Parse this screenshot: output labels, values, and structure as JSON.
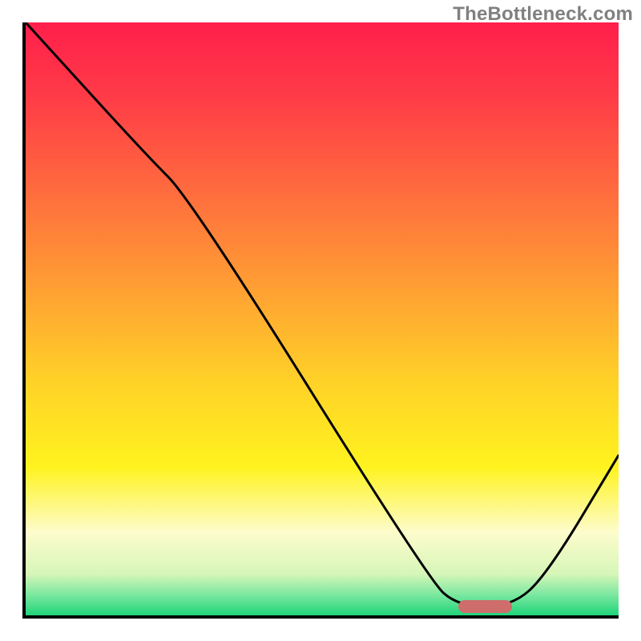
{
  "watermark": "TheBottleneck.com",
  "chart_data": {
    "type": "line",
    "title": "",
    "xlabel": "",
    "ylabel": "",
    "xlim": [
      0,
      100
    ],
    "ylim": [
      0,
      100
    ],
    "gradient_stops": [
      {
        "offset": 0.0,
        "color": "#ff1f4b"
      },
      {
        "offset": 0.12,
        "color": "#ff3a47"
      },
      {
        "offset": 0.28,
        "color": "#ff6a3e"
      },
      {
        "offset": 0.45,
        "color": "#ffa033"
      },
      {
        "offset": 0.6,
        "color": "#ffd028"
      },
      {
        "offset": 0.75,
        "color": "#fff31f"
      },
      {
        "offset": 0.86,
        "color": "#fdfccc"
      },
      {
        "offset": 0.93,
        "color": "#d7f6b8"
      },
      {
        "offset": 0.965,
        "color": "#7ce8a0"
      },
      {
        "offset": 1.0,
        "color": "#1fd47a"
      }
    ],
    "curve": [
      {
        "x": 0,
        "y": 100
      },
      {
        "x": 20,
        "y": 78
      },
      {
        "x": 28,
        "y": 70
      },
      {
        "x": 68,
        "y": 6
      },
      {
        "x": 73,
        "y": 1.5
      },
      {
        "x": 82,
        "y": 1.5
      },
      {
        "x": 88,
        "y": 7
      },
      {
        "x": 100,
        "y": 27
      }
    ],
    "sweet_spot": {
      "x_start": 73,
      "x_end": 82,
      "y": 1.5,
      "height": 2.2
    }
  }
}
